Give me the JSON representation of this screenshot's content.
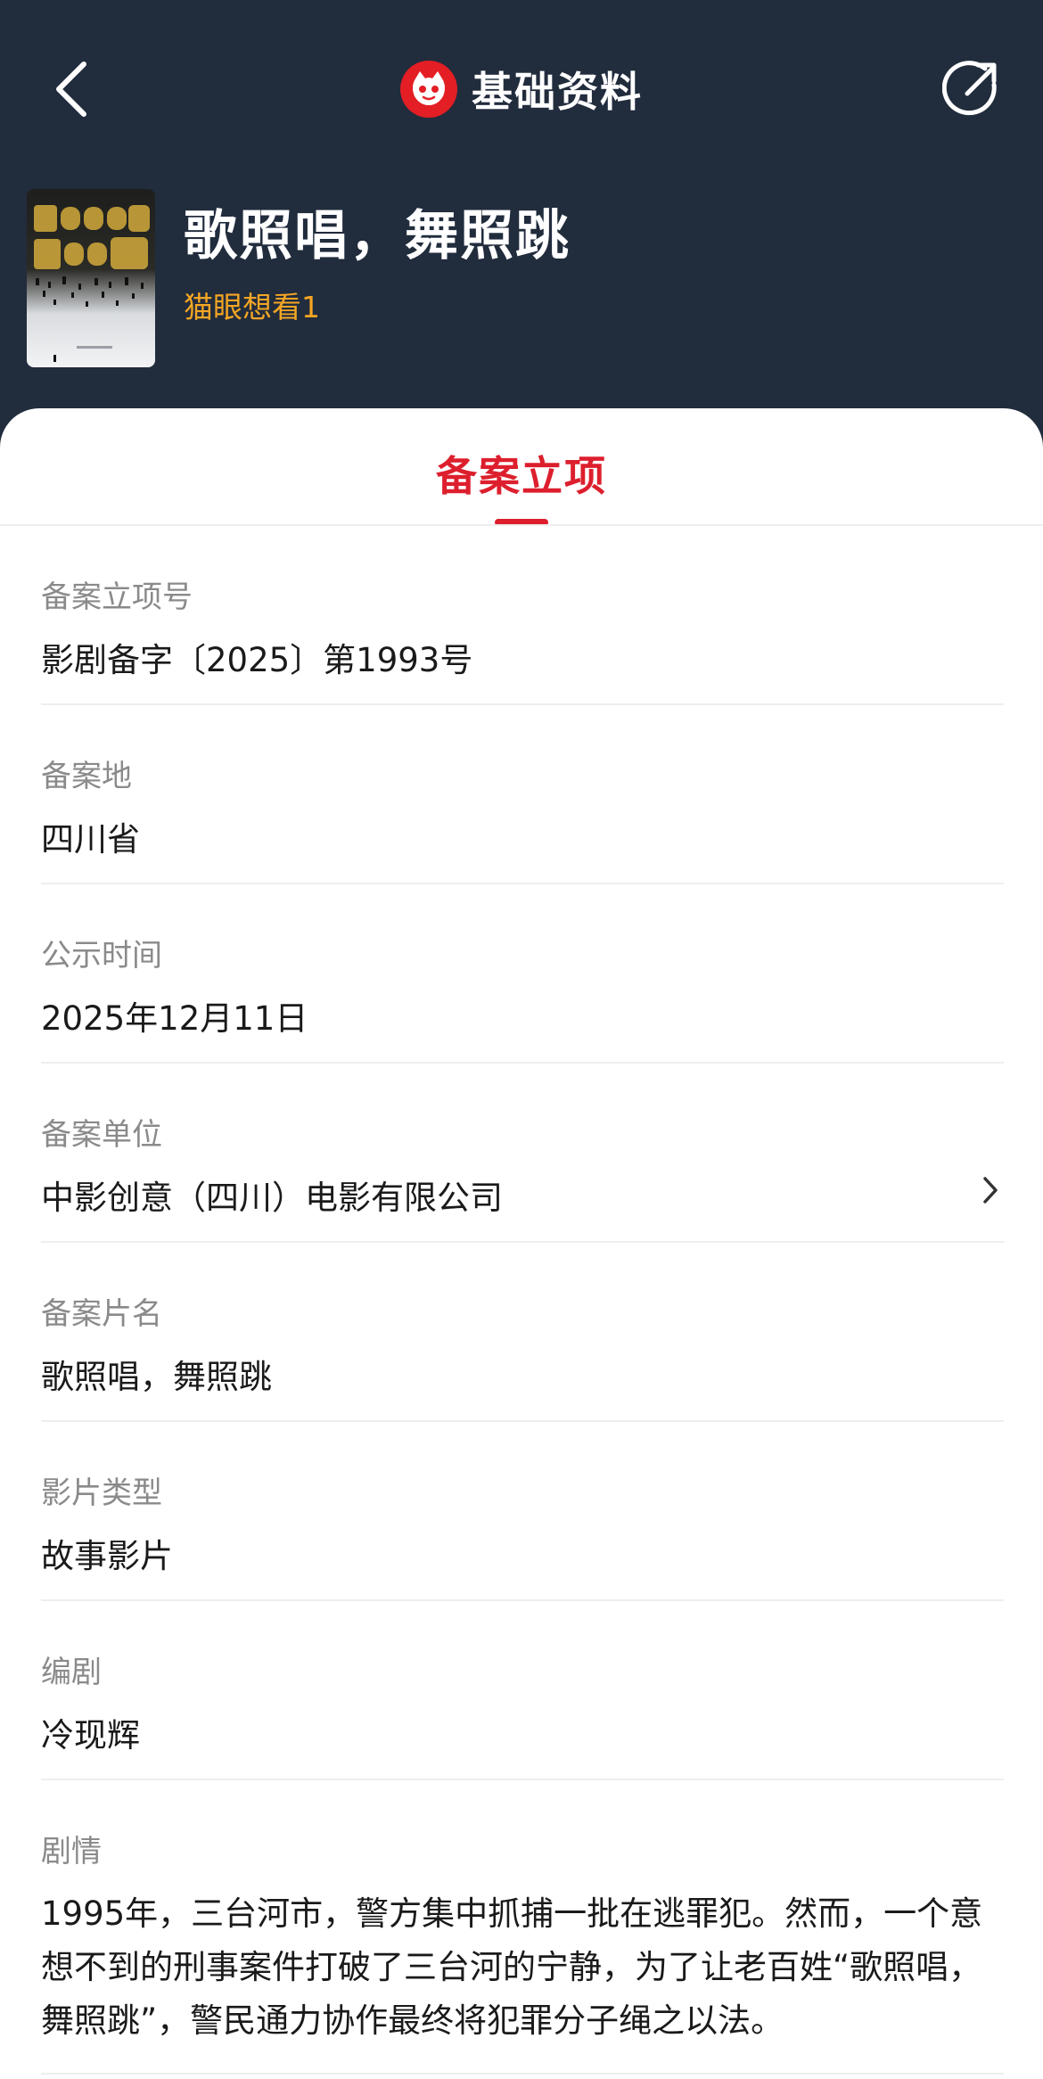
{
  "nav": {
    "title": "基础资料",
    "back_icon": "chevron-left-icon",
    "share_icon": "share-icon",
    "logo_icon": "maoyan-cat-logo"
  },
  "movie": {
    "title": "歌照唱，舞照跳",
    "want_see": "猫眼想看1"
  },
  "tab": {
    "label": "备案立项"
  },
  "rows": [
    {
      "label": "备案立项号",
      "value": "影剧备字〔2025〕第1993号"
    },
    {
      "label": "备案地",
      "value": "四川省"
    },
    {
      "label": "公示时间",
      "value": "2025年12月11日"
    },
    {
      "label": "备案单位",
      "value": "中影创意（四川）电影有限公司"
    },
    {
      "label": "备案片名",
      "value": "歌照唱，舞照跳"
    },
    {
      "label": "影片类型",
      "value": "故事影片"
    },
    {
      "label": "编剧",
      "value": "冷现辉"
    },
    {
      "label": "剧情",
      "value": "1995年，三台河市，警方集中抓捕一批在逃罪犯。然而，一个意想不到的刑事案件打破了三台河的宁静，为了让老百姓“歌照唱，舞照跳”，警民通力协作最终将犯罪分子绳之以法。"
    }
  ],
  "colors": {
    "header_bg": "#212c3d",
    "accent_red": "#dd1f2d",
    "want_see": "#f5a623"
  }
}
